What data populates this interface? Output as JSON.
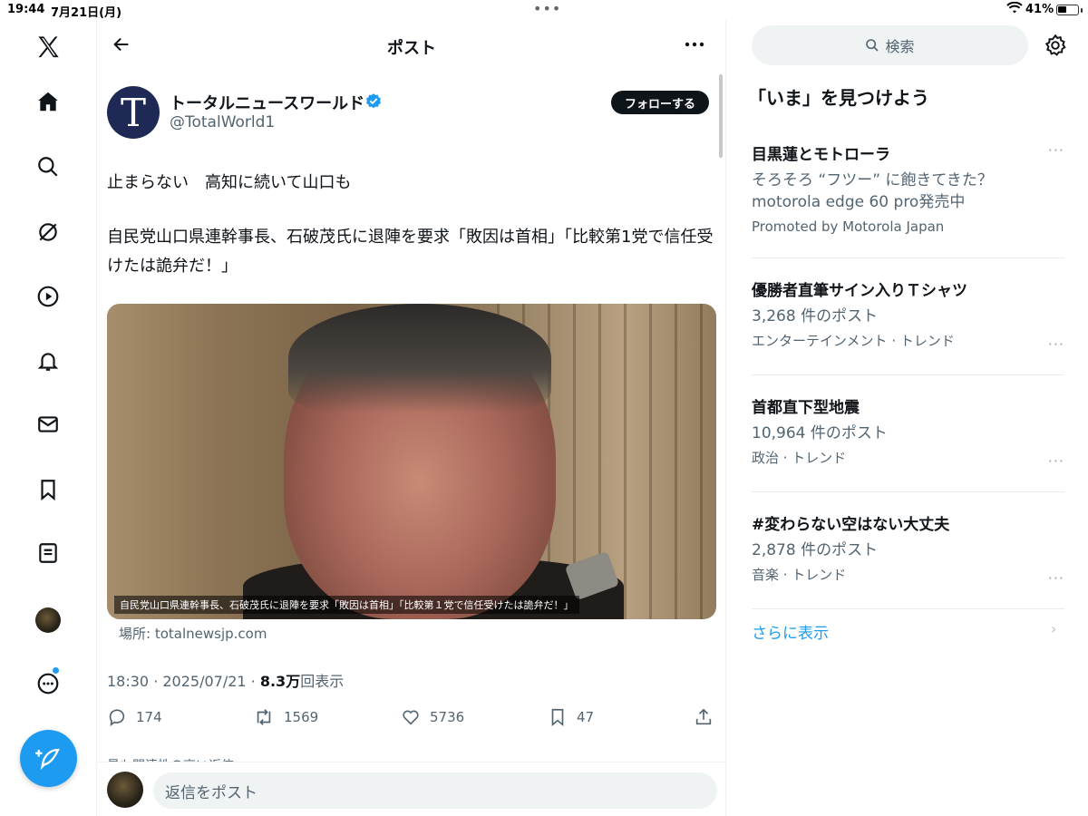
{
  "status_bar": {
    "time": "19:44",
    "date": "7月21日(月)",
    "battery": "41%"
  },
  "nav": {
    "items": [
      "X",
      "ホーム",
      "検索",
      "Grok",
      "動画",
      "通知",
      "メッセージ",
      "ブックマーク",
      "リスト"
    ]
  },
  "header": {
    "title": "ポスト"
  },
  "post": {
    "author_initial": "T",
    "display_name": "トータルニュースワールド",
    "handle": "@TotalWorld1",
    "follow_label": "フォローする",
    "text_line1": "止まらない　高知に続いて山口も",
    "text_line2": "自民党山口県連幹事長、石破茂氏に退陣を要求「敗因は首相」「比較第1党で信任受けたは詭弁だ！」",
    "media_caption": "自民党山口県連幹事長、石破茂氏に退陣を要求「敗因は首相」「比較第１党で信任受けたは詭弁だ！」",
    "source": "場所: totalnewsjp.com",
    "time": "18:30 · 2025/07/21 · ",
    "views_count": "8.3万",
    "views_label": "回表示",
    "replies": "174",
    "reposts": "1569",
    "likes": "5736",
    "bookmarks": "47",
    "cutoff_text": "最も関連性の高い返信",
    "reply_placeholder": "返信をポスト"
  },
  "sidebar": {
    "search_placeholder": "検索",
    "explore_title": "「いま」を見つけよう",
    "trends": [
      {
        "title": "目黒蓮とモトローラ",
        "sub1": "そろそろ “フツー” に飽きてきた？",
        "sub2": "motorola edge 60 pro発売中",
        "meta": "Promoted by Motorola Japan"
      },
      {
        "title": "優勝者直筆サイン入りＴシャツ",
        "count": "3,268 件のポスト",
        "meta": "エンターテインメント · トレンド"
      },
      {
        "title": "首都直下型地震",
        "count": "10,964 件のポスト",
        "meta": "政治 · トレンド"
      },
      {
        "title": "#変わらない空はない大丈夫",
        "count": "2,878 件のポスト",
        "meta": "音楽 · トレンド"
      }
    ],
    "show_more": "さらに表示"
  },
  "colors": {
    "accent": "#1d9bf0",
    "text": "#0f1419",
    "muted": "#536471"
  }
}
